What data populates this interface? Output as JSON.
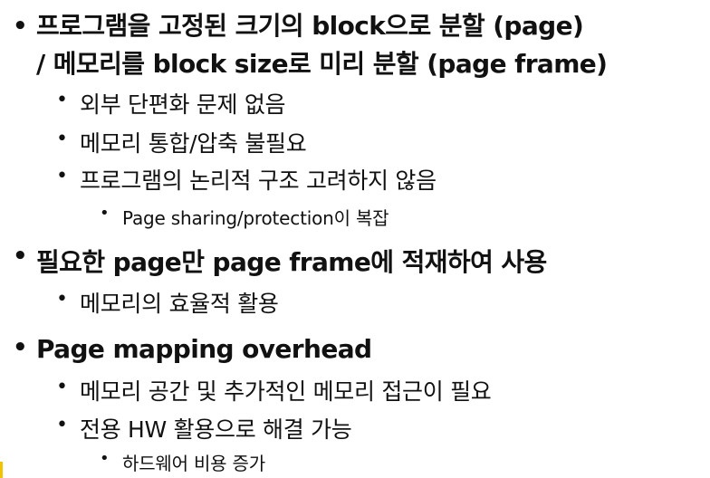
{
  "bullets": [
    {
      "level": 1,
      "lines": [
        "프로그램을 고정된 크기의 block으로 분할 (page)",
        "/ 메모리를 block size로 미리 분할 (page frame)"
      ]
    },
    {
      "level": 2,
      "text": "외부 단편화 문제 없음"
    },
    {
      "level": 2,
      "text": "메모리 통합/압축 불필요"
    },
    {
      "level": 2,
      "text": "프로그램의 논리적 구조 고려하지 않음"
    },
    {
      "level": 3,
      "text": "Page sharing/protection이 복잡"
    },
    {
      "level": 1,
      "text": "필요한 page만 page frame에 적재하여 사용"
    },
    {
      "level": 2,
      "text": "메모리의 효율적 활용"
    },
    {
      "level": 1,
      "text": "Page mapping overhead"
    },
    {
      "level": 2,
      "text": "메모리 공간 및 추가적인 메모리 접근이 필요"
    },
    {
      "level": 2,
      "text": "전용 HW 활용으로 해결 가능"
    },
    {
      "level": 3,
      "text": "하드웨어 비용 증가"
    }
  ],
  "bullet_glyph": "•",
  "accent_color": "#f0c400"
}
